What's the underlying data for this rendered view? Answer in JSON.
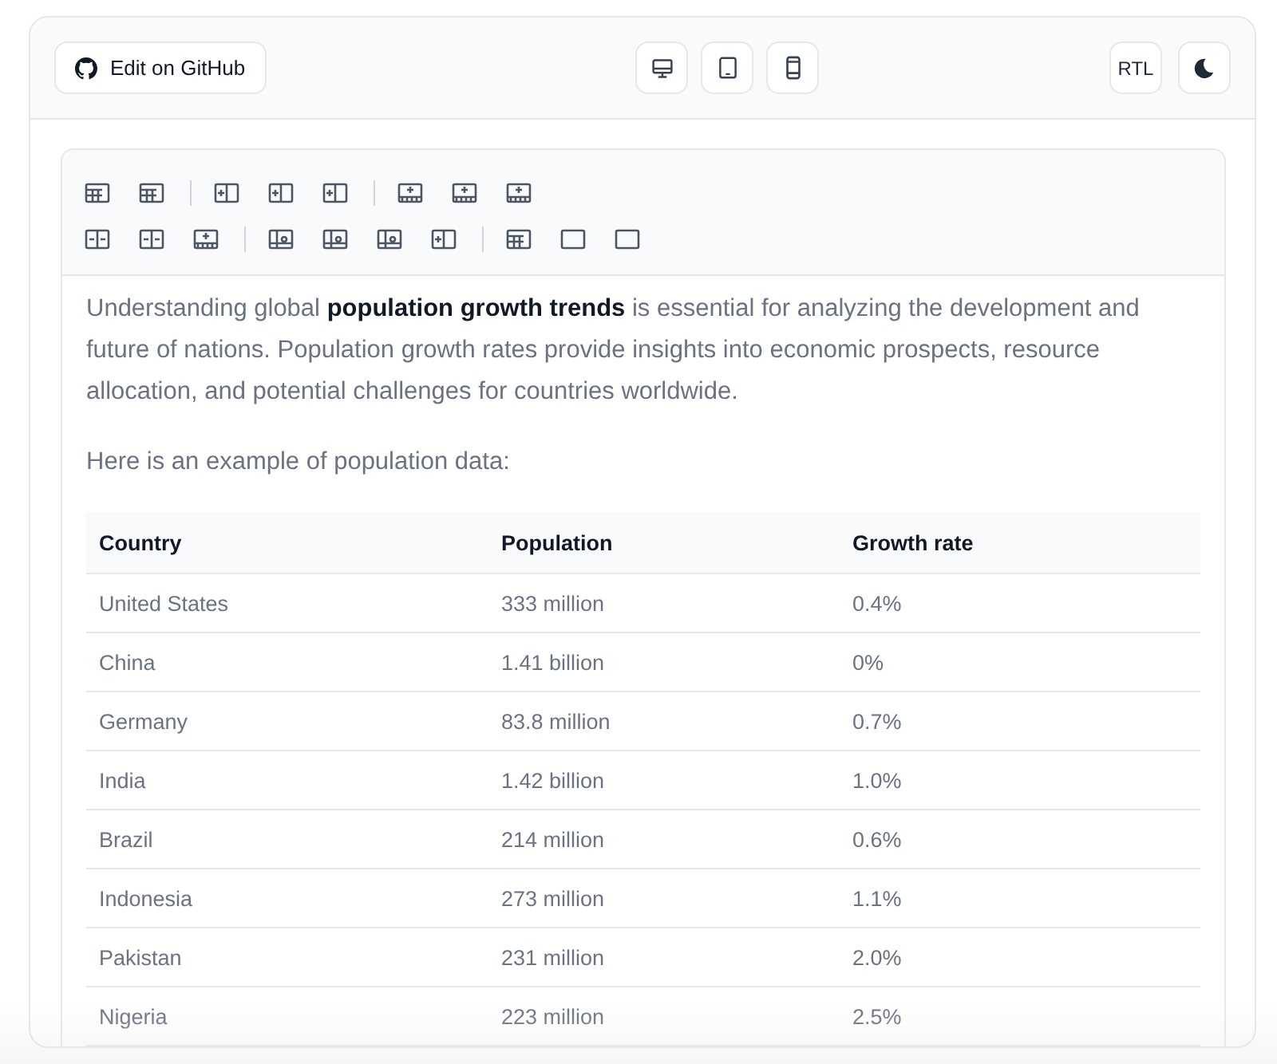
{
  "header": {
    "github_button": "Edit on GitHub",
    "rtl_button": "RTL"
  },
  "editor": {
    "paragraphs": [
      "Understanding global **population growth trends** is essential for analyzing the development and future of nations. Population growth rates provide insights into economic prospects, resource allocation, and potential challenges for countries worldwide.",
      "Here is an example of population data:"
    ],
    "table": {
      "columns": [
        "Country",
        "Population",
        "Growth rate"
      ],
      "rows": [
        [
          "United States",
          "333 million",
          "0.4%"
        ],
        [
          "China",
          "1.41 billion",
          "0%"
        ],
        [
          "Germany",
          "83.8 million",
          "0.7%"
        ],
        [
          "India",
          "1.42 billion",
          "1.0%"
        ],
        [
          "Brazil",
          "214 million",
          "0.6%"
        ],
        [
          "Indonesia",
          "273 million",
          "1.1%"
        ],
        [
          "Pakistan",
          "231 million",
          "2.0%"
        ],
        [
          "Nigeria",
          "223 million",
          "2.5%"
        ]
      ]
    }
  }
}
